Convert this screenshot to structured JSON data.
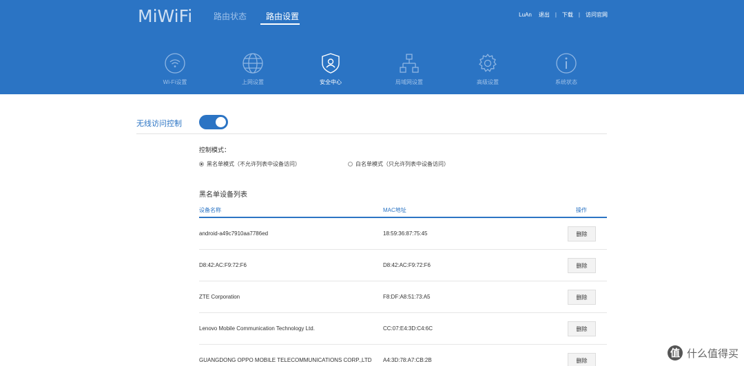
{
  "header": {
    "logo": "MiWiFi",
    "nav": [
      {
        "label": "路由状态",
        "active": false
      },
      {
        "label": "路由设置",
        "active": true
      }
    ],
    "user": "LuAn",
    "links": [
      "退出",
      "下载",
      "访问官网"
    ]
  },
  "settings_nav": [
    {
      "label": "Wi-Fi设置",
      "icon": "wifi-icon",
      "active": false
    },
    {
      "label": "上网设置",
      "icon": "globe-icon",
      "active": false
    },
    {
      "label": "安全中心",
      "icon": "shield-user-icon",
      "active": true
    },
    {
      "label": "局域网设置",
      "icon": "lan-icon",
      "active": false
    },
    {
      "label": "高级设置",
      "icon": "gear-icon",
      "active": false
    },
    {
      "label": "系统状态",
      "icon": "info-icon",
      "active": false
    }
  ],
  "access_control": {
    "label": "无线访问控制",
    "enabled": true,
    "mode_title": "控制模式：",
    "modes": [
      {
        "label": "黑名单模式（不允许列表中设备访问）",
        "selected": true
      },
      {
        "label": "白名单模式（只允许列表中设备访问）",
        "selected": false
      }
    ]
  },
  "blacklist": {
    "title": "黑名单设备列表",
    "columns": [
      "设备名称",
      "MAC地址",
      "操作"
    ],
    "delete_label": "删除",
    "rows": [
      {
        "name": "android-a49c7910aa7786ed",
        "mac": "18:59:36:87:75:45"
      },
      {
        "name": "D8:42:AC:F9:72:F6",
        "mac": "D8:42:AC:F9:72:F6"
      },
      {
        "name": "ZTE Corporation",
        "mac": "F8:DF:A8:51:73:A5"
      },
      {
        "name": "Lenovo Mobile Communication Technology Ltd.",
        "mac": "CC:07:E4:3D:C4:6C"
      },
      {
        "name": "GUANGDONG OPPO MOBILE TELECOMMUNICATIONS CORP.,LTD",
        "mac": "A4:3D:78:A7:CB:2B"
      }
    ]
  },
  "watermark": {
    "badge": "值",
    "text": "什么值得买"
  },
  "colors": {
    "primary": "#2b74c4",
    "header_bg": "#2b74c4"
  }
}
